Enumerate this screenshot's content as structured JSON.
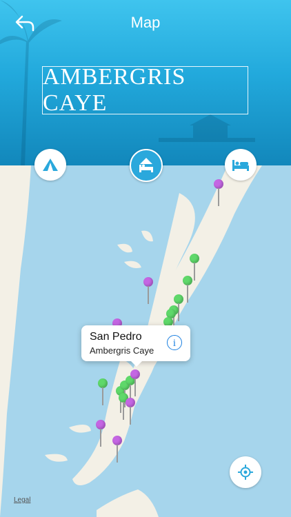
{
  "header": {
    "title": "Map",
    "brand": "AMBERGRIS CAYE"
  },
  "categories": [
    {
      "icon": "tent-icon",
      "active": false
    },
    {
      "icon": "hotel-icon",
      "active": true
    },
    {
      "icon": "bed-icon",
      "active": false
    }
  ],
  "callout": {
    "title": "San Pedro",
    "subtitle": "Ambergris Caye",
    "icon": "info-icon"
  },
  "map": {
    "legal": "Legal",
    "pin_colors": {
      "green": "#5fd86a",
      "purple": "#c466e3"
    }
  },
  "colors": {
    "header_top": "#3fc4ee",
    "header_bottom": "#1287bb",
    "water": "#a6d5ec",
    "land": "#f3f0e6",
    "accent": "#2aa8dc"
  }
}
